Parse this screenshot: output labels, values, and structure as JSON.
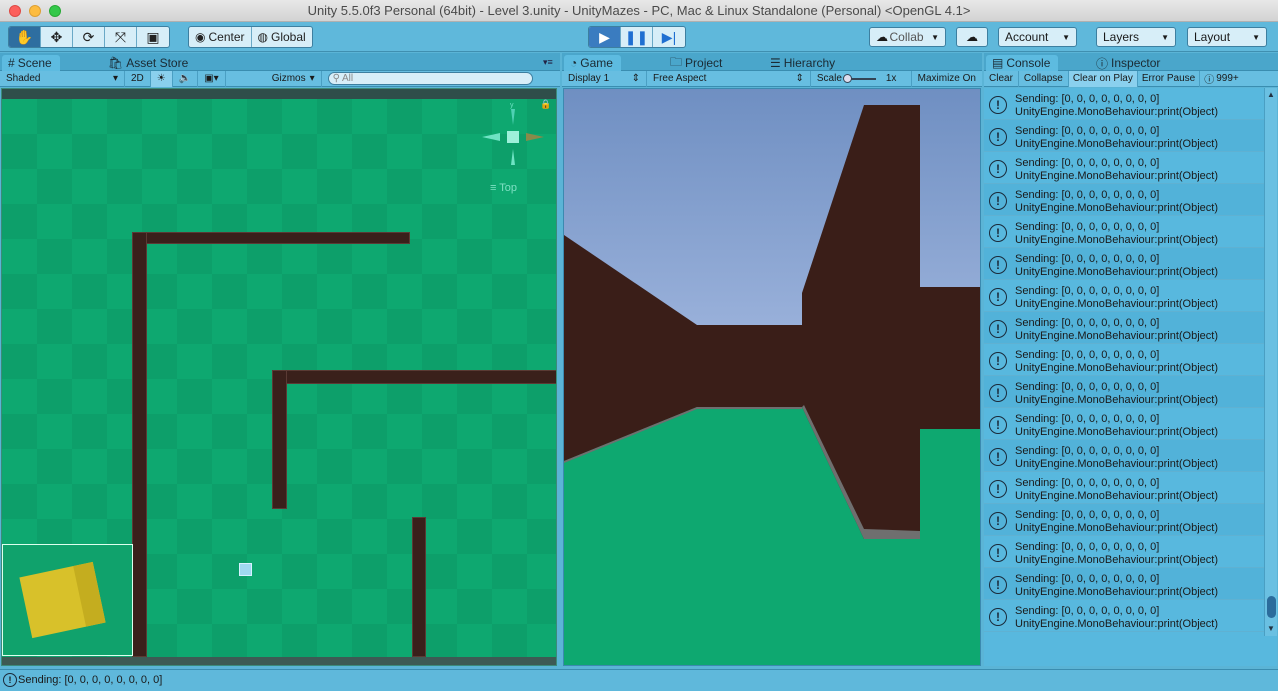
{
  "window": {
    "title": "Unity 5.5.0f3 Personal (64bit) - Level 3.unity - UnityMazes - PC, Mac & Linux Standalone (Personal) <OpenGL 4.1>"
  },
  "toolbar": {
    "tools": [
      "hand-tool",
      "move-tool",
      "rotate-tool",
      "scale-tool",
      "rect-tool"
    ],
    "pivot_label": "Center",
    "space_label": "Global",
    "collab_label": "Collab",
    "account_label": "Account",
    "layers_label": "Layers",
    "layout_label": "Layout"
  },
  "scene_panel": {
    "tabs": [
      {
        "label": "Scene"
      },
      {
        "label": "Asset Store"
      }
    ],
    "shading": "Shaded",
    "mode_2d": "2D",
    "gizmos_label": "Gizmos",
    "search_placeholder": "All",
    "gizmo_label": "Top"
  },
  "game_panel": {
    "tabs": [
      {
        "label": "Game"
      },
      {
        "label": "Project"
      },
      {
        "label": "Hierarchy"
      }
    ],
    "display": "Display 1",
    "aspect": "Free Aspect",
    "scale_label": "Scale",
    "scale_value": "1x",
    "maximize_label": "Maximize On"
  },
  "console_panel": {
    "tabs": [
      {
        "label": "Console"
      },
      {
        "label": "Inspector"
      }
    ],
    "clear_label": "Clear",
    "collapse_label": "Collapse",
    "clear_on_play_label": "Clear on Play",
    "error_pause_label": "Error Pause",
    "count_label": "999+",
    "entries": [
      {
        "line1": "Sending: [0, 0, 0, 0, 0, 0, 0, 0]",
        "line2": "UnityEngine.MonoBehaviour:print(Object)"
      },
      {
        "line1": "Sending: [0, 0, 0, 0, 0, 0, 0, 0]",
        "line2": "UnityEngine.MonoBehaviour:print(Object)"
      },
      {
        "line1": "Sending: [0, 0, 0, 0, 0, 0, 0, 0]",
        "line2": "UnityEngine.MonoBehaviour:print(Object)"
      },
      {
        "line1": "Sending: [0, 0, 0, 0, 0, 0, 0, 0]",
        "line2": "UnityEngine.MonoBehaviour:print(Object)"
      },
      {
        "line1": "Sending: [0, 0, 0, 0, 0, 0, 0, 0]",
        "line2": "UnityEngine.MonoBehaviour:print(Object)"
      },
      {
        "line1": "Sending: [0, 0, 0, 0, 0, 0, 0, 0]",
        "line2": "UnityEngine.MonoBehaviour:print(Object)"
      },
      {
        "line1": "Sending: [0, 0, 0, 0, 0, 0, 0, 0]",
        "line2": "UnityEngine.MonoBehaviour:print(Object)"
      },
      {
        "line1": "Sending: [0, 0, 0, 0, 0, 0, 0, 0]",
        "line2": "UnityEngine.MonoBehaviour:print(Object)"
      },
      {
        "line1": "Sending: [0, 0, 0, 0, 0, 0, 0, 0]",
        "line2": "UnityEngine.MonoBehaviour:print(Object)"
      },
      {
        "line1": "Sending: [0, 0, 0, 0, 0, 0, 0, 0]",
        "line2": "UnityEngine.MonoBehaviour:print(Object)"
      },
      {
        "line1": "Sending: [0, 0, 0, 0, 0, 0, 0, 0]",
        "line2": "UnityEngine.MonoBehaviour:print(Object)"
      },
      {
        "line1": "Sending: [0, 0, 0, 0, 0, 0, 0, 0]",
        "line2": "UnityEngine.MonoBehaviour:print(Object)"
      },
      {
        "line1": "Sending: [0, 0, 0, 0, 0, 0, 0, 0]",
        "line2": "UnityEngine.MonoBehaviour:print(Object)"
      },
      {
        "line1": "Sending: [0, 0, 0, 0, 0, 0, 0, 0]",
        "line2": "UnityEngine.MonoBehaviour:print(Object)"
      },
      {
        "line1": "Sending: [0, 0, 0, 0, 0, 0, 0, 0]",
        "line2": "UnityEngine.MonoBehaviour:print(Object)"
      },
      {
        "line1": "Sending: [0, 0, 0, 0, 0, 0, 0, 0]",
        "line2": "UnityEngine.MonoBehaviour:print(Object)"
      },
      {
        "line1": "Sending: [0, 0, 0, 0, 0, 0, 0, 0]",
        "line2": "UnityEngine.MonoBehaviour:print(Object)"
      }
    ]
  },
  "status_bar": {
    "message": "Sending: [0, 0, 0, 0, 0, 0, 0, 0]"
  },
  "colors": {
    "editor_accent": "#5fb8db",
    "floor_green": "#0ea870",
    "wall_brown": "#3a201b",
    "sky": "#7fa0cf",
    "cube_yellow": "#d8c12a"
  }
}
